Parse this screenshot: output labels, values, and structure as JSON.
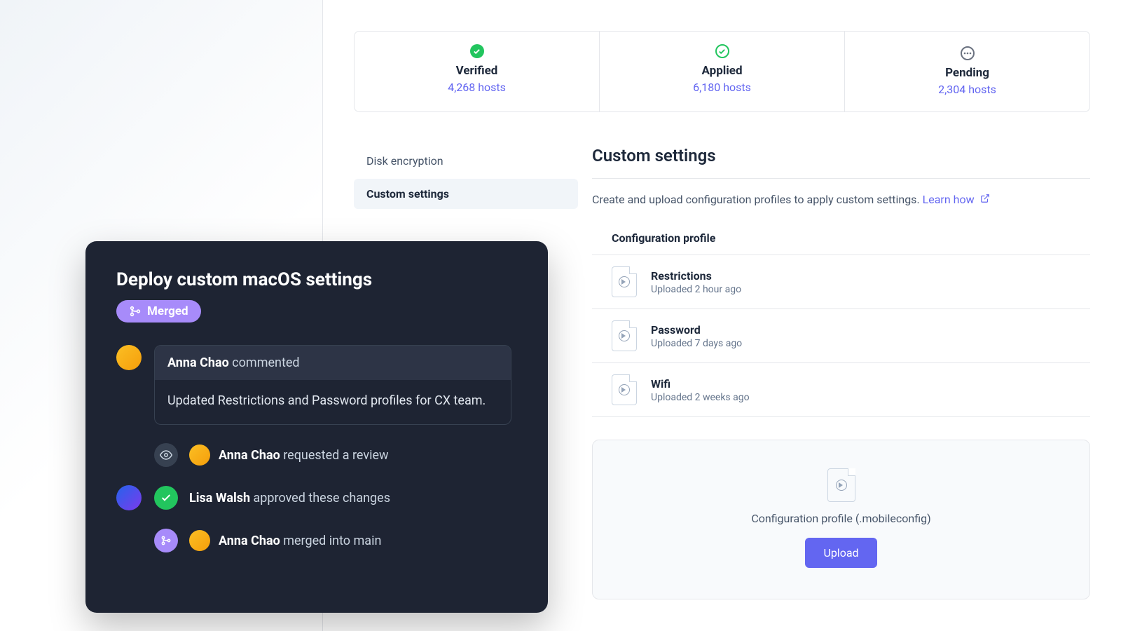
{
  "stats": [
    {
      "label": "Verified",
      "hosts": "4,268 hosts",
      "icon": "check-filled"
    },
    {
      "label": "Applied",
      "hosts": "6,180 hosts",
      "icon": "check-outline"
    },
    {
      "label": "Pending",
      "hosts": "2,304 hosts",
      "icon": "dots"
    }
  ],
  "sidenav": {
    "items": [
      "Disk encryption",
      "Custom settings"
    ],
    "active_index": 1
  },
  "settings": {
    "title": "Custom settings",
    "description": "Create and upload configuration profiles to apply custom settings.",
    "learn_link": "Learn how",
    "profiles_header": "Configuration profile",
    "profiles": [
      {
        "name": "Restrictions",
        "meta": "Uploaded 2 hour ago"
      },
      {
        "name": "Password",
        "meta": "Uploaded 7 days ago"
      },
      {
        "name": "Wifi",
        "meta": "Uploaded 2 weeks ago"
      }
    ],
    "upload_label": "Configuration profile (.mobileconfig)",
    "upload_button": "Upload"
  },
  "pr": {
    "title": "Deploy custom macOS settings",
    "badge": "Merged",
    "comment": {
      "author": "Anna Chao",
      "action": "commented",
      "body": "Updated Restrictions and Password profiles for CX team."
    },
    "events": [
      {
        "icon": "eye",
        "avatar": "anna",
        "author": "Anna Chao",
        "action": "requested a review"
      },
      {
        "icon": "check",
        "avatar": "lisa",
        "author": "Lisa Walsh",
        "action": "approved these changes",
        "class": "approve"
      },
      {
        "icon": "merge",
        "avatar": "anna",
        "author": "Anna Chao",
        "action": "merged into main"
      }
    ]
  }
}
